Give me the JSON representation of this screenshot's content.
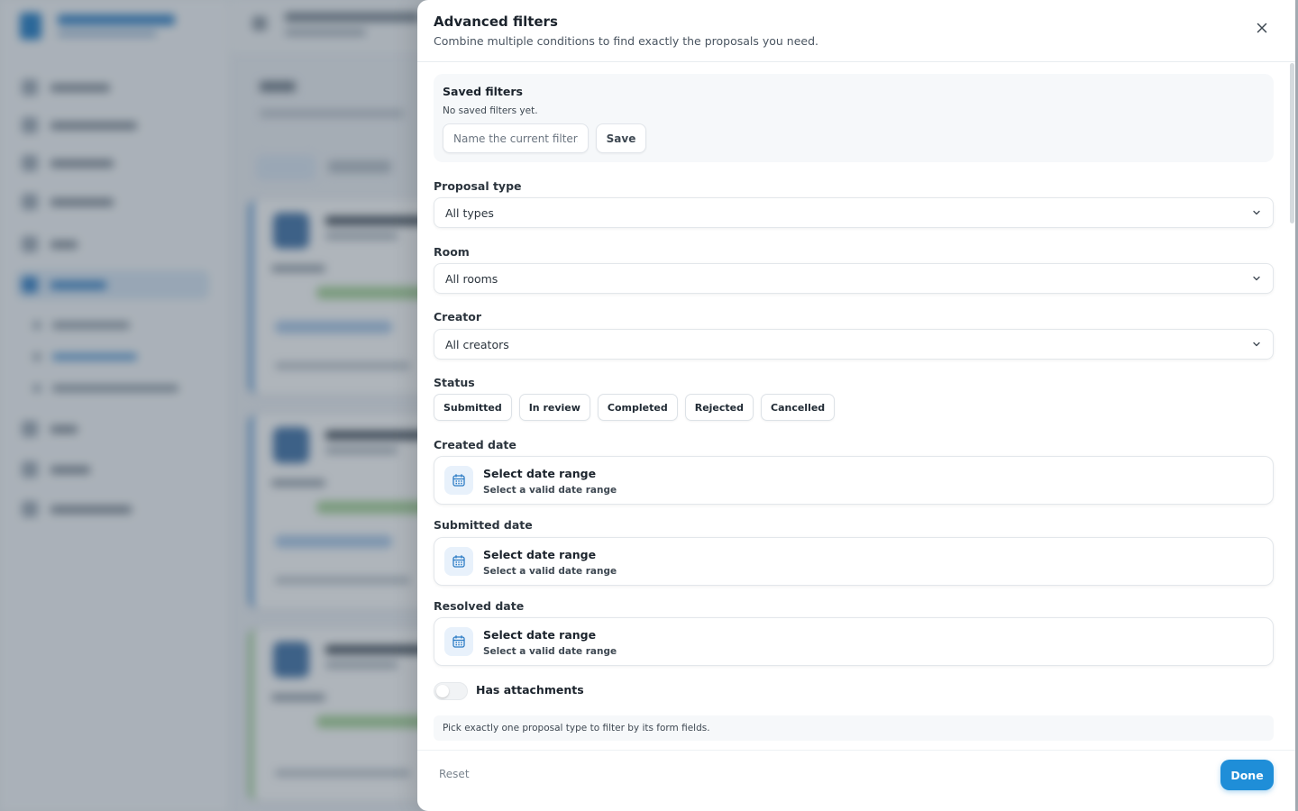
{
  "modal": {
    "title": "Advanced filters",
    "subtitle": "Combine multiple conditions to find exactly the proposals you need.",
    "close_icon": "close-icon"
  },
  "saved_filters": {
    "title": "Saved filters",
    "empty_text": "No saved filters yet.",
    "name_placeholder": "Name the current filter...",
    "save_label": "Save"
  },
  "fields": {
    "proposal_type": {
      "label": "Proposal type",
      "value": "All types"
    },
    "room": {
      "label": "Room",
      "value": "All rooms"
    },
    "creator": {
      "label": "Creator",
      "value": "All creators"
    }
  },
  "status": {
    "label": "Status",
    "options": [
      "Submitted",
      "In review",
      "Completed",
      "Rejected",
      "Cancelled"
    ]
  },
  "dates": [
    {
      "label": "Created date",
      "title": "Select date range",
      "hint": "Select a valid date range"
    },
    {
      "label": "Submitted date",
      "title": "Select date range",
      "hint": "Select a valid date range"
    },
    {
      "label": "Resolved date",
      "title": "Select date range",
      "hint": "Select a valid date range"
    }
  ],
  "attachments": {
    "label": "Has attachments",
    "enabled": false
  },
  "info_text": "Pick exactly one proposal type to filter by its form fields.",
  "footer": {
    "reset_label": "Reset",
    "done_label": "Done"
  },
  "colors": {
    "accent": "#1f8ed8",
    "icon_bg": "#e8f1fb",
    "icon": "#2c7cc5"
  }
}
